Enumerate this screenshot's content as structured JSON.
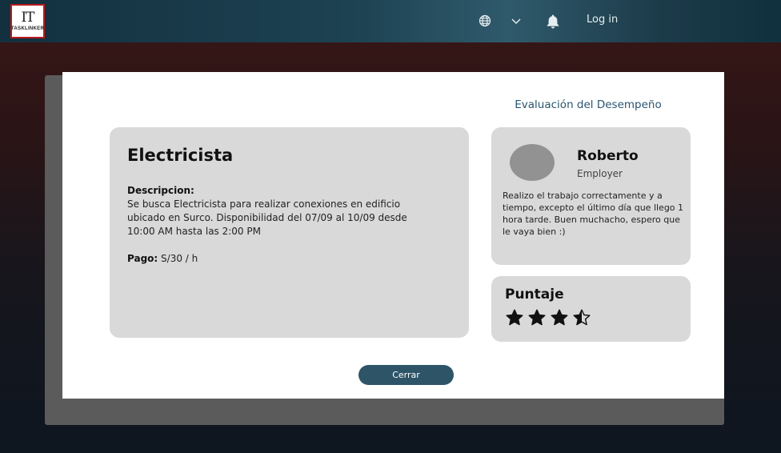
{
  "header": {
    "logo_mark": "IT",
    "logo_text": "TASKLINKER",
    "login_label": "Log in",
    "icons": [
      "globe-icon",
      "chevron-down-icon",
      "bell-icon"
    ]
  },
  "modal": {
    "title": "Evaluación del Desempeño",
    "job": {
      "title": "Electricista",
      "description_label": "Descripcion:",
      "description": "Se busca Electricista para realizar conexiones en edificio ubicado en Surco. Disponibilidad del 07/09 al 10/09 desde 10:00 AM hasta las 2:00 PM",
      "pay_label": "Pago:",
      "pay_value": "S/30 / h"
    },
    "review": {
      "name": "Roberto",
      "role": "Employer",
      "text": "Realizo el trabajo correctamente y a tiempo, excepto el último día que llego 1 hora tarde. Buen muchacho, espero que le vaya bien :)"
    },
    "score": {
      "label": "Puntaje",
      "rating": 3.5,
      "max": 4
    },
    "close_label": "Cerrar"
  },
  "colors": {
    "accent": "#2e5468",
    "card": "#d9d9d9",
    "title": "#2a5570"
  }
}
